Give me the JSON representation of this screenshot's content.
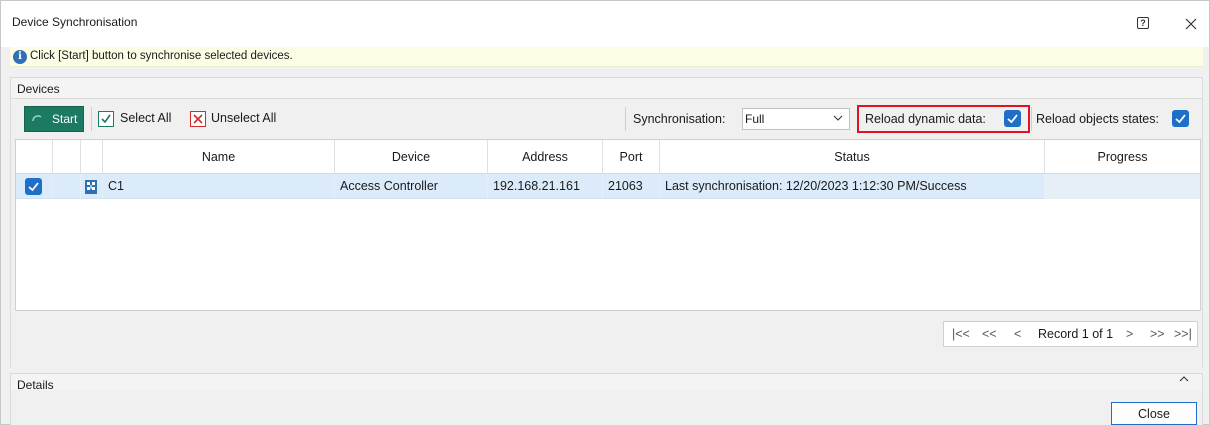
{
  "window": {
    "title": "Device Synchronisation"
  },
  "info": {
    "message": "Click [Start] button to synchronise selected devices."
  },
  "devices_group": {
    "label": "Devices"
  },
  "toolbar": {
    "start_label": "Start",
    "select_all_label": "Select All",
    "unselect_all_label": "Unselect All",
    "sync_label": "Synchronisation:",
    "sync_value": "Full",
    "reload_dynamic_label": "Reload dynamic data:",
    "reload_dynamic_checked": true,
    "reload_states_label": "Reload objects states:",
    "reload_states_checked": true
  },
  "grid": {
    "columns": {
      "name": "Name",
      "device": "Device",
      "address": "Address",
      "port": "Port",
      "status": "Status",
      "progress": "Progress"
    },
    "rows": [
      {
        "checked": true,
        "name": "C1",
        "device": "Access Controller",
        "address": "192.168.21.161",
        "port": "21063",
        "status": "Last synchronisation: 12/20/2023 1:12:30 PM/Success",
        "progress": ""
      }
    ]
  },
  "pager": {
    "first": "|<<",
    "prev_page": "<<",
    "prev": "<",
    "record_text": "Record 1 of 1",
    "next": ">",
    "next_page": ">>",
    "last": ">>|"
  },
  "details_group": {
    "label": "Details"
  },
  "footer": {
    "close_label": "Close"
  },
  "colors": {
    "accent": "#1c7a62",
    "highlight": "#e0141e",
    "check_blue": "#1f6fc9",
    "row_selected": "#dcebf9",
    "info_bg": "#fdfde5"
  }
}
